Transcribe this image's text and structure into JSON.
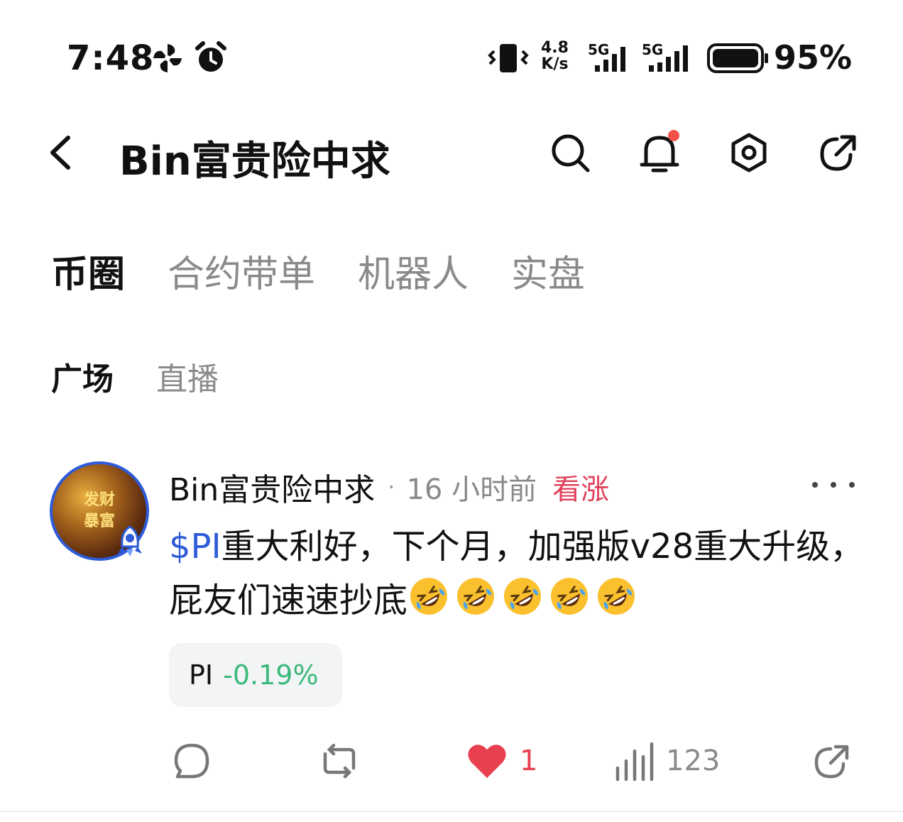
{
  "status_bar": {
    "time": "7:48",
    "net_speed_value": "4.8",
    "net_speed_unit": "K/s",
    "sim1_label": "5G",
    "sim2_label": "5G",
    "battery_percent": "95%",
    "icons": [
      "pinwheel-icon",
      "alarm-icon",
      "vibrate-icon",
      "signal-icon",
      "battery-icon"
    ]
  },
  "header": {
    "title": "Bin富贵险中求",
    "icons": [
      "back-arrow-icon",
      "search-icon",
      "bell-icon",
      "settings-hex-icon",
      "share-icon"
    ],
    "notification_dot_color": "#f0524a"
  },
  "tabs_primary": [
    {
      "label": "币圈",
      "active": true
    },
    {
      "label": "合约带单",
      "active": false
    },
    {
      "label": "机器人",
      "active": false
    },
    {
      "label": "实盘",
      "active": false
    }
  ],
  "tabs_secondary": [
    {
      "label": "广场",
      "active": true
    },
    {
      "label": "直播",
      "active": false
    }
  ],
  "post": {
    "avatar_text_line1": "发财",
    "avatar_text_line2": "暴富",
    "author": "Bin富贵险中求",
    "separator": "·",
    "time_ago": "16 小时前",
    "sentiment": "看涨",
    "ticker_link": "$PI",
    "body_text": "重大利好，下个月，加强版v28重大升级，屁友们速速抄底",
    "emoji_name": "rolling-on-floor-laughing-emoji",
    "emoji_count": 5,
    "chip_symbol": "PI",
    "chip_change": "-0.19%",
    "actions": {
      "comment_icon": "comment-icon",
      "repost_icon": "repost-icon",
      "like_icon": "heart-icon",
      "like_count": "1",
      "views_icon": "bar-chart-icon",
      "view_count": "123",
      "share_icon": "share-icon"
    }
  },
  "colors": {
    "accent_blue": "#2e5bd8",
    "bullish_red": "#e0405a",
    "negative_green": "#3cb87a",
    "like_red": "#e8404f",
    "muted_gray": "#8a8a8a"
  }
}
